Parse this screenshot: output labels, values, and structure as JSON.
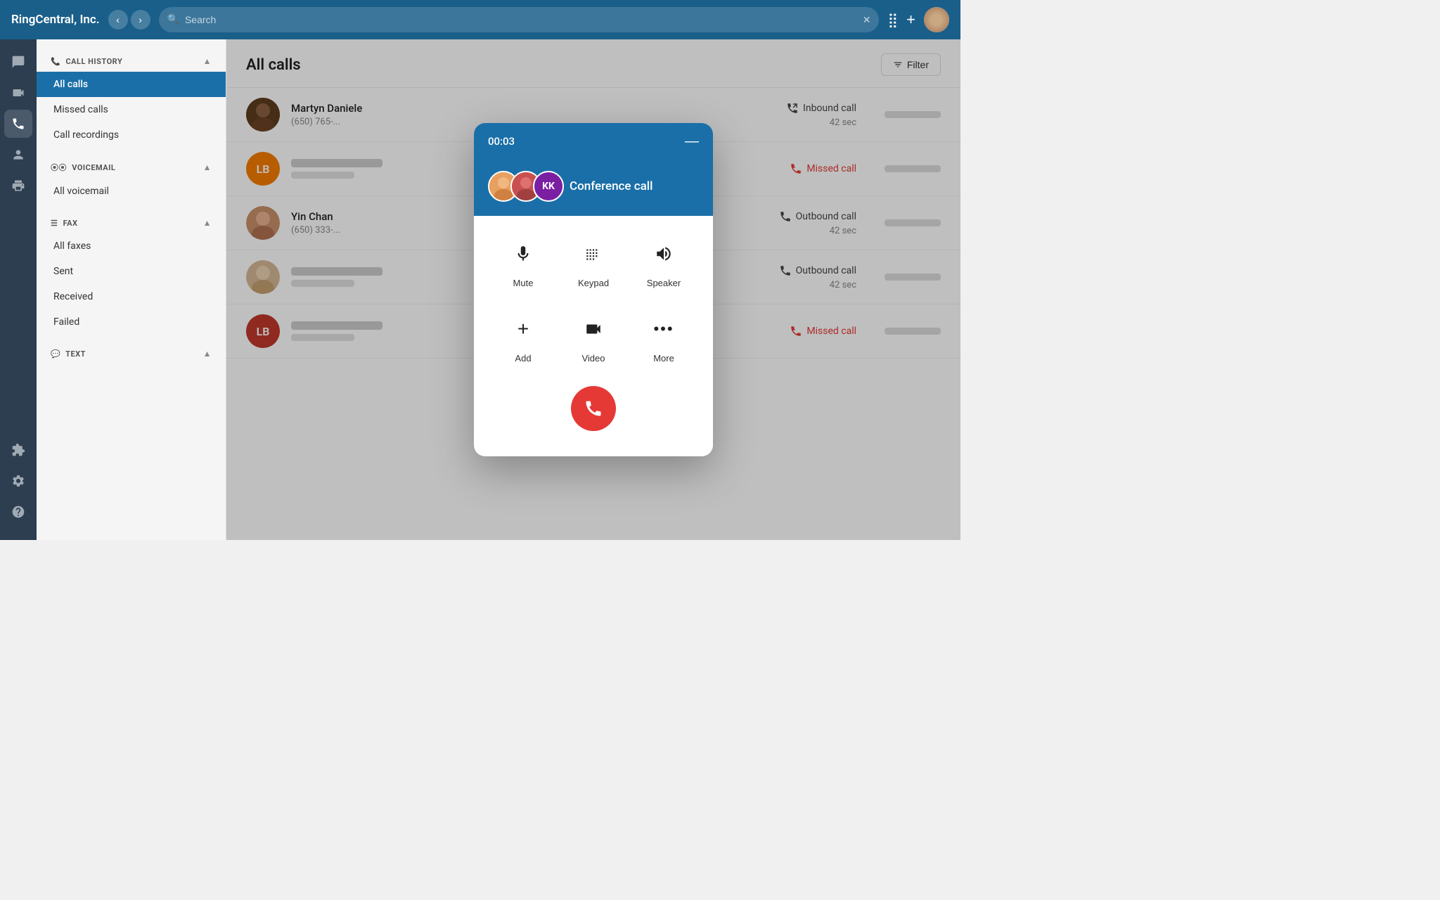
{
  "app": {
    "title": "RingCentral, Inc.",
    "search_placeholder": "Search"
  },
  "topbar": {
    "grid_icon": "⣿",
    "plus_icon": "+",
    "nav_back": "‹",
    "nav_forward": "›",
    "filter_label": "Filter"
  },
  "sidebar_icons": [
    {
      "id": "chat",
      "label": "Chat",
      "icon": "💬"
    },
    {
      "id": "video",
      "label": "Video",
      "icon": "🎥"
    },
    {
      "id": "phone",
      "label": "Phone",
      "icon": "📞",
      "active": true
    },
    {
      "id": "contacts",
      "label": "Contacts",
      "icon": "👤"
    },
    {
      "id": "fax",
      "label": "Fax",
      "icon": "📠"
    }
  ],
  "sidebar_bottom_icons": [
    {
      "id": "extensions",
      "label": "Extensions",
      "icon": "🧩"
    },
    {
      "id": "settings",
      "label": "Settings",
      "icon": "⚙"
    },
    {
      "id": "help",
      "label": "Help",
      "icon": "?"
    }
  ],
  "left_nav": {
    "call_history": {
      "section_label": "CALL HISTORY",
      "items": [
        {
          "id": "all-calls",
          "label": "All calls",
          "active": true
        },
        {
          "id": "missed-calls",
          "label": "Missed calls"
        },
        {
          "id": "call-recordings",
          "label": "Call recordings"
        }
      ]
    },
    "voicemail": {
      "section_label": "VOICEMAIL",
      "items": [
        {
          "id": "all-voicemail",
          "label": "All voicemail"
        }
      ]
    },
    "fax": {
      "section_label": "FAX",
      "items": [
        {
          "id": "all-faxes",
          "label": "All faxes"
        },
        {
          "id": "sent",
          "label": "Sent"
        },
        {
          "id": "received",
          "label": "Received"
        },
        {
          "id": "failed",
          "label": "Failed"
        }
      ]
    },
    "text": {
      "section_label": "TEXT"
    }
  },
  "main": {
    "title": "All calls",
    "calls": [
      {
        "id": 1,
        "name": "Martyn Daniele",
        "number": "(650) 765-...",
        "avatar_initials": "",
        "avatar_type": "photo_man",
        "call_type": "Inbound call",
        "call_icon": "inbound",
        "duration": "42 sec",
        "missed": false
      },
      {
        "id": 2,
        "name": "",
        "number": "",
        "avatar_initials": "LB",
        "avatar_color": "#f57c00",
        "call_type": "Missed call",
        "call_icon": "missed",
        "duration": "",
        "missed": true
      },
      {
        "id": 3,
        "name": "Yin Chan",
        "number": "(650) 333-...",
        "avatar_initials": "",
        "avatar_type": "photo_woman_asian",
        "call_type": "Outbound call",
        "call_icon": "outbound",
        "duration": "42 sec",
        "missed": false
      },
      {
        "id": 4,
        "name": "",
        "number": "",
        "avatar_initials": "",
        "avatar_type": "photo_woman_blond",
        "call_type": "Outbound call",
        "call_icon": "outbound",
        "duration": "42 sec",
        "missed": false
      },
      {
        "id": 5,
        "name": "",
        "number": "",
        "avatar_initials": "LB",
        "avatar_color": "#c0392b",
        "call_type": "Missed call",
        "call_icon": "missed",
        "duration": "",
        "missed": true
      }
    ]
  },
  "call_modal": {
    "timer": "00:03",
    "label": "Conference call",
    "controls": [
      {
        "id": "mute",
        "icon": "🎤",
        "label": "Mute"
      },
      {
        "id": "keypad",
        "icon": "⌨",
        "label": "Keypad"
      },
      {
        "id": "speaker",
        "icon": "🔊",
        "label": "Speaker"
      },
      {
        "id": "add",
        "icon": "+",
        "label": "Add"
      },
      {
        "id": "video",
        "icon": "📷",
        "label": "Video"
      },
      {
        "id": "more",
        "icon": "•••",
        "label": "More"
      }
    ],
    "end_call_label": "End call"
  }
}
